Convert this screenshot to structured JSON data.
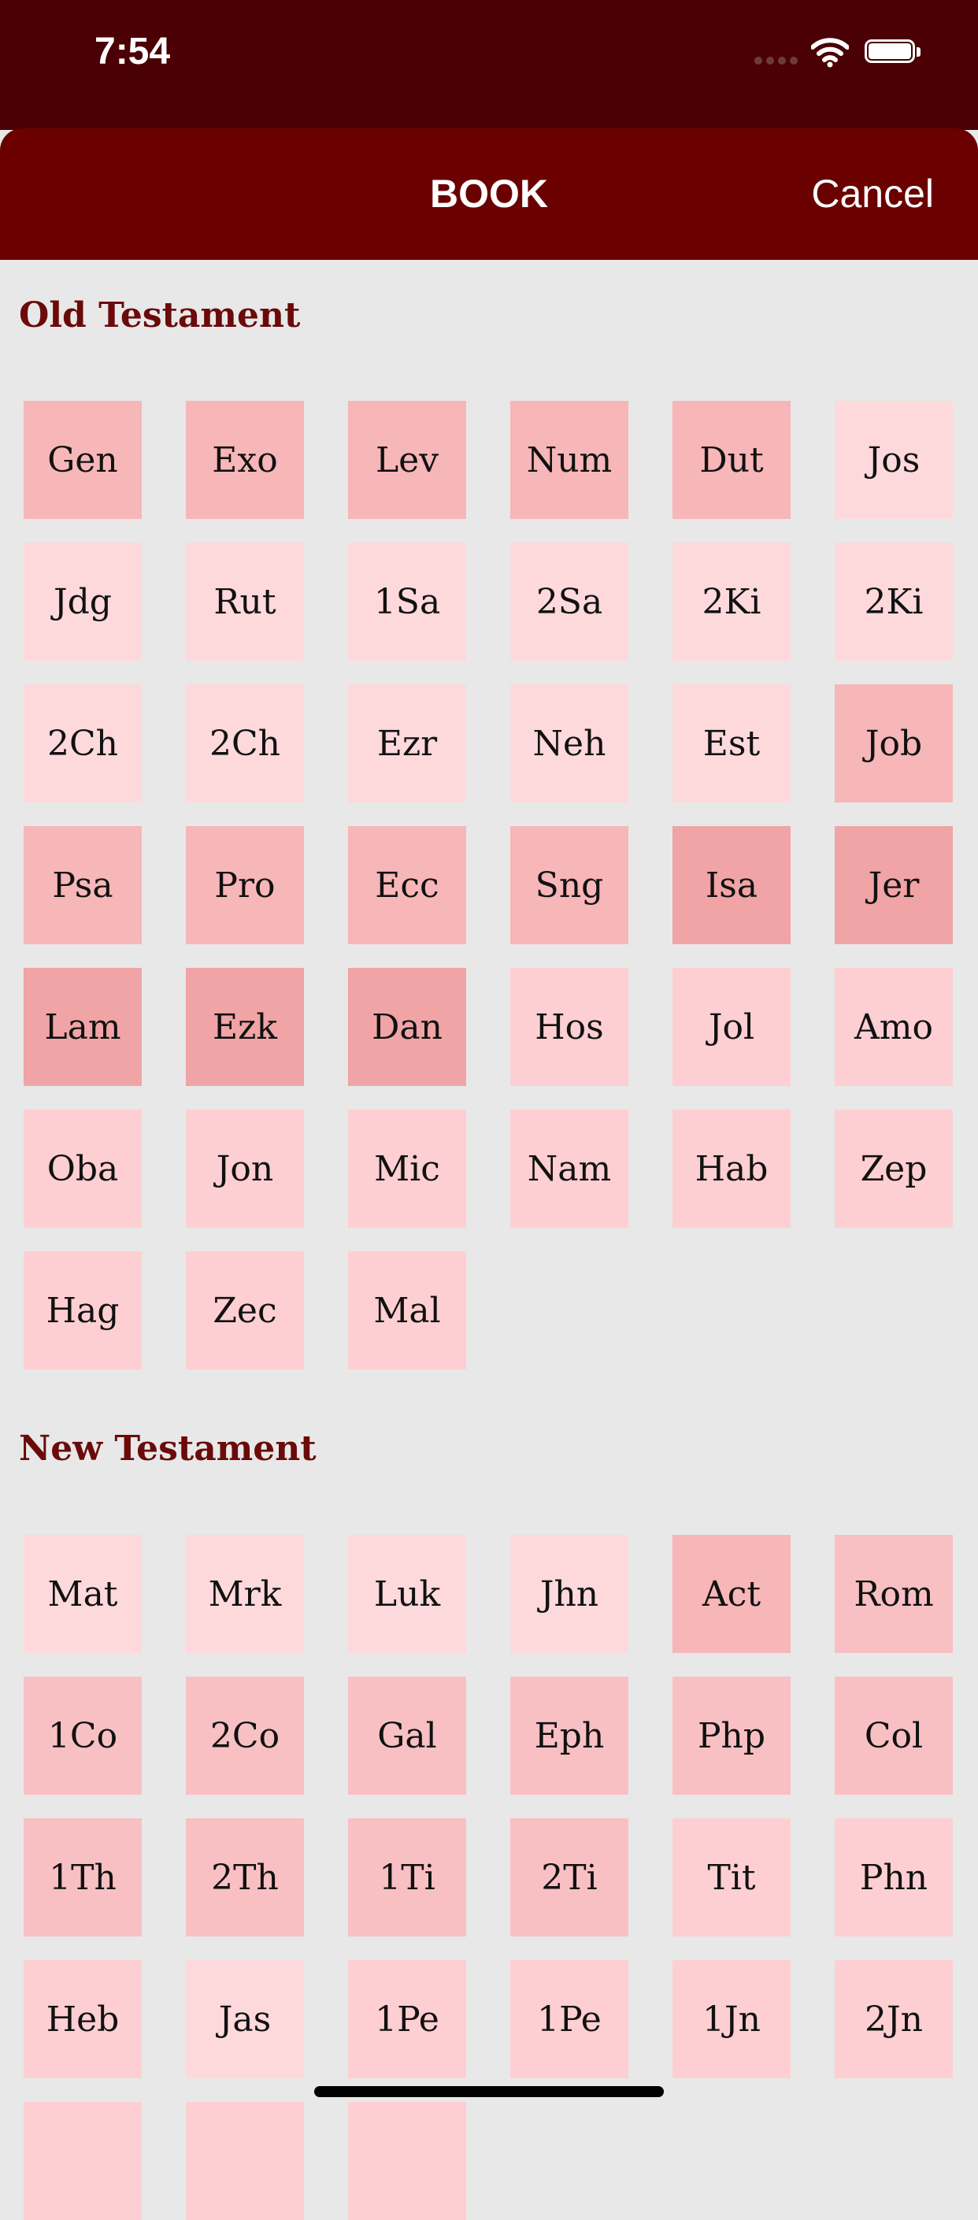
{
  "status_bar": {
    "time": "7:54"
  },
  "header": {
    "title": "BOOK",
    "cancel_label": "Cancel"
  },
  "old_testament": {
    "title": "Old Testament",
    "books": [
      {
        "label": "Gen",
        "color": "#f7b6b8"
      },
      {
        "label": "Exo",
        "color": "#f7b6b8"
      },
      {
        "label": "Lev",
        "color": "#f7b6b8"
      },
      {
        "label": "Num",
        "color": "#f7b6b8"
      },
      {
        "label": "Dut",
        "color": "#f7b6b8"
      },
      {
        "label": "Jos",
        "color": "#fdd9dc"
      },
      {
        "label": "Jdg",
        "color": "#fdd9dc"
      },
      {
        "label": "Rut",
        "color": "#fdd9dc"
      },
      {
        "label": "1Sa",
        "color": "#fdd9dc"
      },
      {
        "label": "2Sa",
        "color": "#fdd9dc"
      },
      {
        "label": "2Ki",
        "color": "#fdd9dc"
      },
      {
        "label": "2Ki",
        "color": "#fdd9dc"
      },
      {
        "label": "2Ch",
        "color": "#fdd9dc"
      },
      {
        "label": "2Ch",
        "color": "#fdd9dc"
      },
      {
        "label": "Ezr",
        "color": "#fdd9dc"
      },
      {
        "label": "Neh",
        "color": "#fdd9dc"
      },
      {
        "label": "Est",
        "color": "#fdd9dc"
      },
      {
        "label": "Job",
        "color": "#f7b6b8"
      },
      {
        "label": "Psa",
        "color": "#f7b6b8"
      },
      {
        "label": "Pro",
        "color": "#f7b6b8"
      },
      {
        "label": "Ecc",
        "color": "#f7b6b8"
      },
      {
        "label": "Sng",
        "color": "#f7b6b8"
      },
      {
        "label": "Isa",
        "color": "#f0a4a6"
      },
      {
        "label": "Jer",
        "color": "#f0a4a6"
      },
      {
        "label": "Lam",
        "color": "#f0a4a6"
      },
      {
        "label": "Ezk",
        "color": "#f0a4a6"
      },
      {
        "label": "Dan",
        "color": "#f0a4a6"
      },
      {
        "label": "Hos",
        "color": "#fdcfd2"
      },
      {
        "label": "Jol",
        "color": "#fdcfd2"
      },
      {
        "label": "Amo",
        "color": "#fdcfd2"
      },
      {
        "label": "Oba",
        "color": "#fdcfd2"
      },
      {
        "label": "Jon",
        "color": "#fdcfd2"
      },
      {
        "label": "Mic",
        "color": "#fdcfd2"
      },
      {
        "label": "Nam",
        "color": "#fdcfd2"
      },
      {
        "label": "Hab",
        "color": "#fdcfd2"
      },
      {
        "label": "Zep",
        "color": "#fdcfd2"
      },
      {
        "label": "Hag",
        "color": "#fdcfd2"
      },
      {
        "label": "Zec",
        "color": "#fdcfd2"
      },
      {
        "label": "Mal",
        "color": "#fdcfd2"
      }
    ]
  },
  "new_testament": {
    "title": "New Testament",
    "books": [
      {
        "label": "Mat",
        "color": "#fdd9dc"
      },
      {
        "label": "Mrk",
        "color": "#fdd9dc"
      },
      {
        "label": "Luk",
        "color": "#fdd9dc"
      },
      {
        "label": "Jhn",
        "color": "#fdd9dc"
      },
      {
        "label": "Act",
        "color": "#f7b6b8"
      },
      {
        "label": "Rom",
        "color": "#f9c0c3"
      },
      {
        "label": "1Co",
        "color": "#f9c0c3"
      },
      {
        "label": "2Co",
        "color": "#f9c0c3"
      },
      {
        "label": "Gal",
        "color": "#f9c0c3"
      },
      {
        "label": "Eph",
        "color": "#f9c0c3"
      },
      {
        "label": "Php",
        "color": "#f9c0c3"
      },
      {
        "label": "Col",
        "color": "#f9c0c3"
      },
      {
        "label": "1Th",
        "color": "#f9c0c3"
      },
      {
        "label": "2Th",
        "color": "#f9c0c3"
      },
      {
        "label": "1Ti",
        "color": "#f9c0c3"
      },
      {
        "label": "2Ti",
        "color": "#f9c0c3"
      },
      {
        "label": "Tit",
        "color": "#fdcfd2"
      },
      {
        "label": "Phn",
        "color": "#fdcfd2"
      },
      {
        "label": "Heb",
        "color": "#fdcfd2"
      },
      {
        "label": "Jas",
        "color": "#fdd9dc"
      },
      {
        "label": "1Pe",
        "color": "#fdcfd2"
      },
      {
        "label": "1Pe",
        "color": "#fdcfd2"
      },
      {
        "label": "1Jn",
        "color": "#fdcfd2"
      },
      {
        "label": "2Jn",
        "color": "#fdcfd2"
      },
      {
        "label": "",
        "color": "#fdcfd2"
      },
      {
        "label": "",
        "color": "#fdcfd2"
      },
      {
        "label": "",
        "color": "#fdcfd2"
      }
    ]
  }
}
